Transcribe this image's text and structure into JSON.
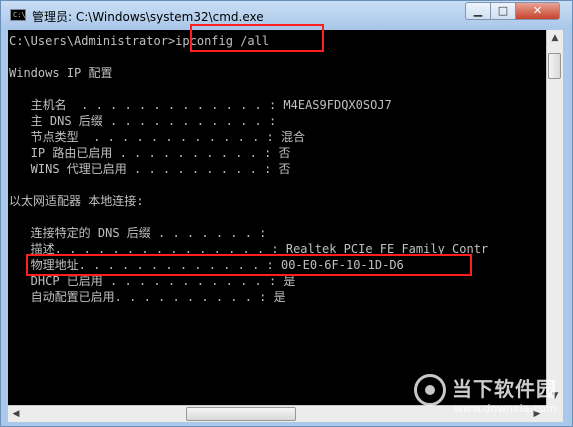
{
  "window": {
    "title": "管理员: C:\\Windows\\system32\\cmd.exe",
    "icon_label": "C:\\",
    "controls": {
      "minimize": "▁",
      "maximize": "□",
      "close": "✕"
    }
  },
  "console": {
    "lines": [
      "C:\\Users\\Administrator>ipconfig /all",
      "",
      "Windows IP 配置",
      "",
      "   主机名  . . . . . . . . . . . . . : M4EAS9FDQX0SOJ7",
      "   主 DNS 后缀 . . . . . . . . . . . :",
      "   节点类型  . . . . . . . . . . . . : 混合",
      "   IP 路由已启用 . . . . . . . . . . : 否",
      "   WINS 代理已启用 . . . . . . . . . : 否",
      "",
      "以太网适配器 本地连接:",
      "",
      "   连接特定的 DNS 后缀 . . . . . . . :",
      "   描述. . . . . . . . . . . . . . . : Realtek PCIe FE Family Contr",
      "   物理地址. . . . . . . . . . . . . : 00-E0-6F-10-1D-D6",
      "   DHCP 已启用 . . . . . . . . . . . : 是",
      "   自动配置已启用. . . . . . . . . . : 是"
    ]
  },
  "scrollbars": {
    "up": "▲",
    "down": "▼",
    "left": "◀",
    "right": "▶"
  },
  "watermark": {
    "brand": "当下软件园",
    "url": "www.downxia.com"
  },
  "highlights": {
    "color": "#ff1f1f"
  }
}
